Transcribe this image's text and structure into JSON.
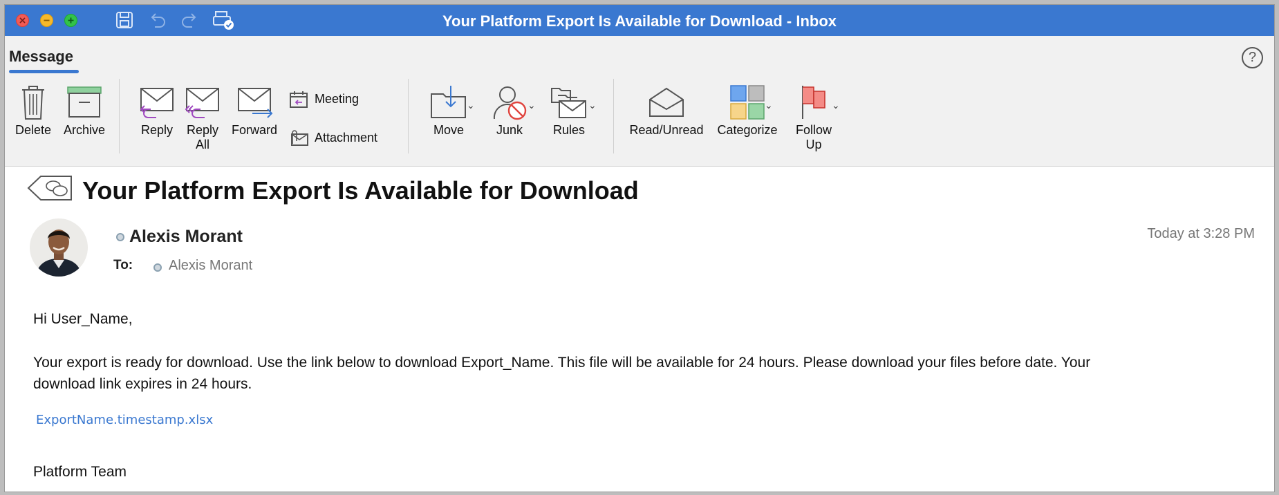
{
  "window": {
    "title": "Your Platform Export Is Available for Download - Inbox"
  },
  "ribbon": {
    "tab": "Message",
    "help": "?",
    "buttons": {
      "delete": "Delete",
      "archive": "Archive",
      "reply": "Reply",
      "reply_all_1": "Reply",
      "reply_all_2": "All",
      "forward": "Forward",
      "meeting": "Meeting",
      "attachment": "Attachment",
      "move": "Move",
      "junk": "Junk",
      "rules": "Rules",
      "read_unread": "Read/Unread",
      "categorize": "Categorize",
      "follow_up_1": "Follow",
      "follow_up_2": "Up"
    }
  },
  "message": {
    "subject": "Your Platform Export Is Available for Download",
    "sender": "Alexis Morant",
    "to_label": "To:",
    "to_name": "Alexis Morant",
    "time": "Today at 3:28 PM",
    "greeting": "Hi User_Name,",
    "body_line1": "Your export is ready for download.  Use the link below to download Export_Name.  This file will be available for 24 hours. Please download your files before date. Your",
    "body_line2": "download link expires in 24 hours.",
    "link": "ExportName.timestamp.xlsx",
    "signature": "Platform Team"
  },
  "colors": {
    "title_bar": "#3a78d0",
    "link": "#3a78d0",
    "ribbon_bg": "#f1f1f1"
  }
}
